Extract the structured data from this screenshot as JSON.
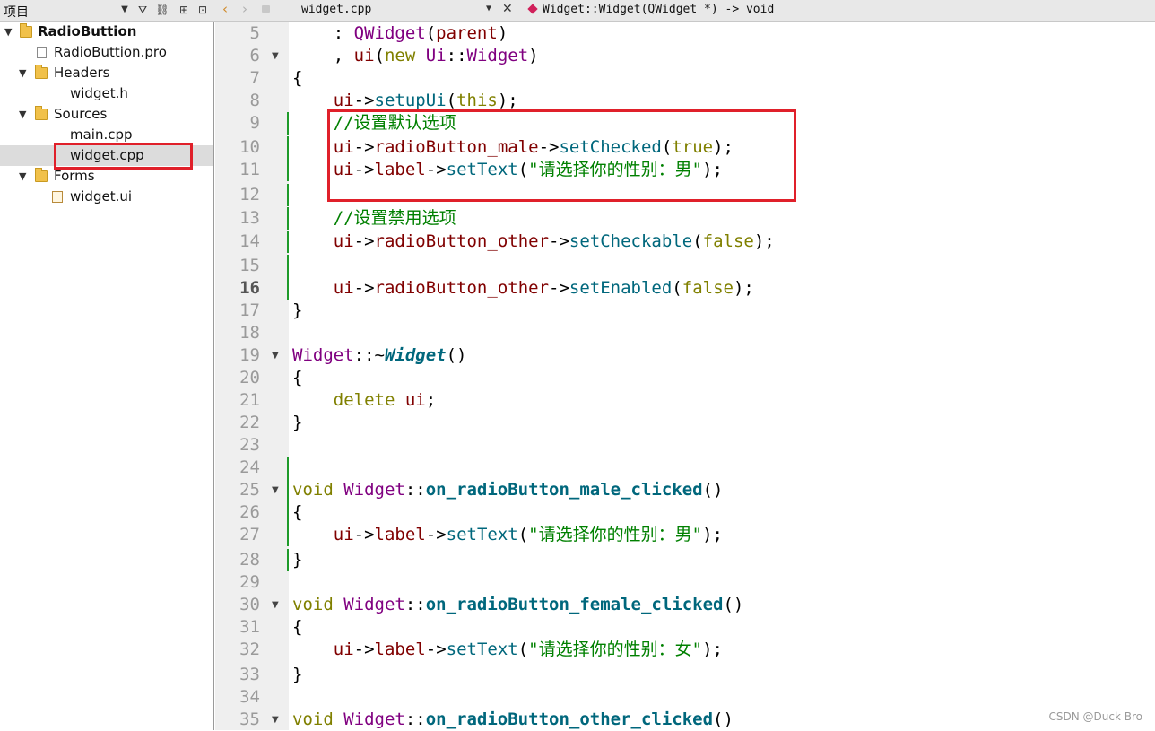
{
  "project_pane": {
    "title": "项目",
    "tree": [
      {
        "label": "RadioButtion",
        "kind": "project",
        "expanded": true
      },
      {
        "label": "RadioButtion.pro",
        "kind": "pro-file"
      },
      {
        "label": "Headers",
        "kind": "folder",
        "expanded": true
      },
      {
        "label": "widget.h",
        "kind": "file"
      },
      {
        "label": "Sources",
        "kind": "folder",
        "expanded": true
      },
      {
        "label": "main.cpp",
        "kind": "file"
      },
      {
        "label": "widget.cpp",
        "kind": "file",
        "selected": true
      },
      {
        "label": "Forms",
        "kind": "folder",
        "expanded": true
      },
      {
        "label": "widget.ui",
        "kind": "ui-file"
      }
    ],
    "toolbar_icons": [
      "chevron-down-icon",
      "filter-icon",
      "link-icon",
      "split-icon",
      "close-pane-icon"
    ]
  },
  "editor_toolbar": {
    "file": "widget.cpp",
    "symbol": "Widget::Widget(QWidget *) -> void",
    "icons": [
      "back-arrow-icon",
      "forward-arrow-icon",
      "lock-icon",
      "close-icon",
      "method-icon"
    ]
  },
  "editor": {
    "current_line": 16,
    "lines": [
      {
        "n": "5",
        "fold": false,
        "changed": false,
        "tokens": [
          [
            "plain",
            "    : "
          ],
          [
            "cls",
            "QWidget"
          ],
          [
            "plain",
            "("
          ],
          [
            "var",
            "parent"
          ],
          [
            "plain",
            ")"
          ]
        ]
      },
      {
        "n": "6",
        "fold": true,
        "changed": false,
        "tokens": [
          [
            "plain",
            "    , "
          ],
          [
            "var",
            "ui"
          ],
          [
            "plain",
            "("
          ],
          [
            "kw",
            "new "
          ],
          [
            "cls",
            "Ui"
          ],
          [
            "plain",
            "::"
          ],
          [
            "cls",
            "Widget"
          ],
          [
            "plain",
            ")"
          ]
        ]
      },
      {
        "n": "7",
        "fold": false,
        "changed": false,
        "tokens": [
          [
            "plain",
            "{"
          ]
        ]
      },
      {
        "n": "8",
        "fold": false,
        "changed": false,
        "tokens": [
          [
            "plain",
            "    "
          ],
          [
            "var",
            "ui"
          ],
          [
            "plain",
            "->"
          ],
          [
            "fn",
            "setupUi"
          ],
          [
            "plain",
            "("
          ],
          [
            "kw",
            "this"
          ],
          [
            "plain",
            ");"
          ]
        ]
      },
      {
        "n": "9",
        "fold": false,
        "changed": true,
        "tokens": [
          [
            "plain",
            "    "
          ],
          [
            "cmt",
            "//设置默认选项"
          ]
        ]
      },
      {
        "n": "10",
        "fold": false,
        "changed": true,
        "tokens": [
          [
            "plain",
            "    "
          ],
          [
            "var",
            "ui"
          ],
          [
            "plain",
            "->"
          ],
          [
            "var",
            "radioButton_male"
          ],
          [
            "plain",
            "->"
          ],
          [
            "fn",
            "setChecked"
          ],
          [
            "plain",
            "("
          ],
          [
            "kw",
            "true"
          ],
          [
            "plain",
            ");"
          ]
        ]
      },
      {
        "n": "11",
        "fold": false,
        "changed": true,
        "tokens": [
          [
            "plain",
            "    "
          ],
          [
            "var",
            "ui"
          ],
          [
            "plain",
            "->"
          ],
          [
            "var",
            "label"
          ],
          [
            "plain",
            "->"
          ],
          [
            "fn",
            "setText"
          ],
          [
            "plain",
            "("
          ],
          [
            "str",
            "\"请选择你的性别：男\""
          ],
          [
            "plain",
            ");"
          ]
        ]
      },
      {
        "n": "12",
        "fold": false,
        "changed": true,
        "tokens": []
      },
      {
        "n": "13",
        "fold": false,
        "changed": true,
        "tokens": [
          [
            "plain",
            "    "
          ],
          [
            "cmt",
            "//设置禁用选项"
          ]
        ]
      },
      {
        "n": "14",
        "fold": false,
        "changed": true,
        "tokens": [
          [
            "plain",
            "    "
          ],
          [
            "var",
            "ui"
          ],
          [
            "plain",
            "->"
          ],
          [
            "var",
            "radioButton_other"
          ],
          [
            "plain",
            "->"
          ],
          [
            "fn",
            "setCheckable"
          ],
          [
            "plain",
            "("
          ],
          [
            "kw",
            "false"
          ],
          [
            "plain",
            ");"
          ]
        ]
      },
      {
        "n": "15",
        "fold": false,
        "changed": true,
        "tokens": []
      },
      {
        "n": "16",
        "fold": false,
        "changed": true,
        "tokens": [
          [
            "plain",
            "    "
          ],
          [
            "var",
            "ui"
          ],
          [
            "plain",
            "->"
          ],
          [
            "var",
            "radioButton_other"
          ],
          [
            "plain",
            "->"
          ],
          [
            "fn",
            "setEnabled"
          ],
          [
            "plain",
            "("
          ],
          [
            "kw",
            "false"
          ],
          [
            "plain",
            ");"
          ]
        ]
      },
      {
        "n": "17",
        "fold": false,
        "changed": false,
        "tokens": [
          [
            "plain",
            "}"
          ]
        ]
      },
      {
        "n": "18",
        "fold": false,
        "changed": false,
        "tokens": []
      },
      {
        "n": "19",
        "fold": true,
        "changed": false,
        "tokens": [
          [
            "cls",
            "Widget"
          ],
          [
            "plain",
            "::~"
          ],
          [
            "fni",
            "Widget"
          ],
          [
            "plain",
            "()"
          ]
        ]
      },
      {
        "n": "20",
        "fold": false,
        "changed": false,
        "tokens": [
          [
            "plain",
            "{"
          ]
        ]
      },
      {
        "n": "21",
        "fold": false,
        "changed": false,
        "tokens": [
          [
            "plain",
            "    "
          ],
          [
            "kw",
            "delete "
          ],
          [
            "var",
            "ui"
          ],
          [
            "plain",
            ";"
          ]
        ]
      },
      {
        "n": "22",
        "fold": false,
        "changed": false,
        "tokens": [
          [
            "plain",
            "}"
          ]
        ]
      },
      {
        "n": "23",
        "fold": false,
        "changed": false,
        "tokens": []
      },
      {
        "n": "24",
        "fold": false,
        "changed": true,
        "tokens": []
      },
      {
        "n": "25",
        "fold": true,
        "changed": true,
        "tokens": [
          [
            "kw",
            "void "
          ],
          [
            "cls",
            "Widget"
          ],
          [
            "plain",
            "::"
          ],
          [
            "fnb",
            "on_radioButton_male_clicked"
          ],
          [
            "plain",
            "()"
          ]
        ]
      },
      {
        "n": "26",
        "fold": false,
        "changed": true,
        "tokens": [
          [
            "plain",
            "{"
          ]
        ]
      },
      {
        "n": "27",
        "fold": false,
        "changed": true,
        "tokens": [
          [
            "plain",
            "    "
          ],
          [
            "var",
            "ui"
          ],
          [
            "plain",
            "->"
          ],
          [
            "var",
            "label"
          ],
          [
            "plain",
            "->"
          ],
          [
            "fn",
            "setText"
          ],
          [
            "plain",
            "("
          ],
          [
            "str",
            "\"请选择你的性别：男\""
          ],
          [
            "plain",
            ");"
          ]
        ]
      },
      {
        "n": "28",
        "fold": false,
        "changed": true,
        "tokens": [
          [
            "plain",
            "}"
          ]
        ]
      },
      {
        "n": "29",
        "fold": false,
        "changed": false,
        "tokens": []
      },
      {
        "n": "30",
        "fold": true,
        "changed": false,
        "tokens": [
          [
            "kw",
            "void "
          ],
          [
            "cls",
            "Widget"
          ],
          [
            "plain",
            "::"
          ],
          [
            "fnb",
            "on_radioButton_female_clicked"
          ],
          [
            "plain",
            "()"
          ]
        ]
      },
      {
        "n": "31",
        "fold": false,
        "changed": false,
        "tokens": [
          [
            "plain",
            "{"
          ]
        ]
      },
      {
        "n": "32",
        "fold": false,
        "changed": false,
        "tokens": [
          [
            "plain",
            "    "
          ],
          [
            "var",
            "ui"
          ],
          [
            "plain",
            "->"
          ],
          [
            "var",
            "label"
          ],
          [
            "plain",
            "->"
          ],
          [
            "fn",
            "setText"
          ],
          [
            "plain",
            "("
          ],
          [
            "str",
            "\"请选择你的性别：女\""
          ],
          [
            "plain",
            ");"
          ]
        ]
      },
      {
        "n": "33",
        "fold": false,
        "changed": false,
        "tokens": [
          [
            "plain",
            "}"
          ]
        ]
      },
      {
        "n": "34",
        "fold": false,
        "changed": false,
        "tokens": []
      },
      {
        "n": "35",
        "fold": true,
        "changed": false,
        "tokens": [
          [
            "kw",
            "void "
          ],
          [
            "cls",
            "Widget"
          ],
          [
            "plain",
            "::"
          ],
          [
            "fnb",
            "on_radioButton_other_clicked"
          ],
          [
            "plain",
            "()"
          ]
        ]
      }
    ]
  },
  "watermark": "CSDN @Duck Bro",
  "colors": {
    "highlight_box": "#e0202a",
    "change_bar": "#1e9a2a",
    "keyword": "#808000",
    "class": "#800080",
    "member": "#800000",
    "function": "#00677c",
    "string": "#008000"
  }
}
